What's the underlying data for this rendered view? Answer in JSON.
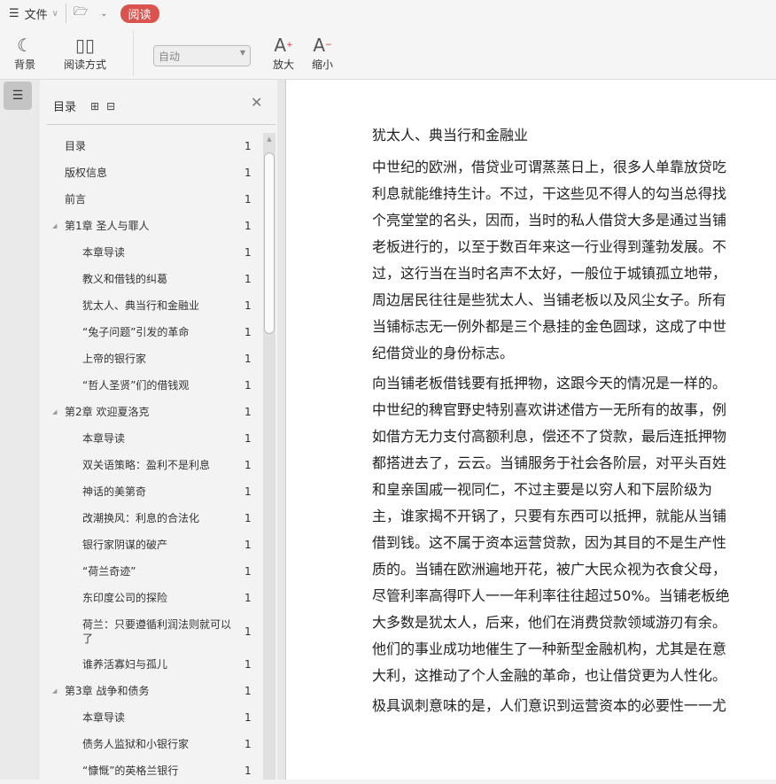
{
  "toolbar": {
    "file": "文件",
    "read_badge": "阅读",
    "background": "背景",
    "reading_mode": "阅读方式",
    "select_value": "自动",
    "zoom_in": "放大",
    "zoom_out": "缩小"
  },
  "toc": {
    "title": "目录",
    "items": [
      {
        "label": "目录",
        "page": "1",
        "level": 0
      },
      {
        "label": "版权信息",
        "page": "1",
        "level": 0
      },
      {
        "label": "前言",
        "page": "1",
        "level": 0
      },
      {
        "label": "第1章 圣人与罪人",
        "page": "1",
        "level": 0,
        "expandable": true
      },
      {
        "label": "本章导读",
        "page": "1",
        "level": 1
      },
      {
        "label": "教义和借钱的纠葛",
        "page": "1",
        "level": 1
      },
      {
        "label": "犹太人、典当行和金融业",
        "page": "1",
        "level": 1
      },
      {
        "label": "“兔子问题”引发的革命",
        "page": "1",
        "level": 1
      },
      {
        "label": "上帝的银行家",
        "page": "1",
        "level": 1
      },
      {
        "label": "“哲人圣贤”们的借钱观",
        "page": "1",
        "level": 1
      },
      {
        "label": "第2章 欢迎夏洛克",
        "page": "1",
        "level": 0,
        "expandable": true
      },
      {
        "label": "本章导读",
        "page": "1",
        "level": 1
      },
      {
        "label": "双关语策略：盈利不是利息",
        "page": "1",
        "level": 1
      },
      {
        "label": "神话的美第奇",
        "page": "1",
        "level": 1
      },
      {
        "label": "改潮换风：利息的合法化",
        "page": "1",
        "level": 1
      },
      {
        "label": "银行家阴谋的破产",
        "page": "1",
        "level": 1
      },
      {
        "label": "“荷兰奇迹”",
        "page": "1",
        "level": 1
      },
      {
        "label": "东印度公司的探险",
        "page": "1",
        "level": 1
      },
      {
        "label": "荷兰：只要遵循利润法则就可以了",
        "page": "1",
        "level": 1,
        "tall": true
      },
      {
        "label": "谁养活寡妇与孤儿",
        "page": "1",
        "level": 1
      },
      {
        "label": "第3章 战争和债务",
        "page": "1",
        "level": 0,
        "expandable": true
      },
      {
        "label": "本章导读",
        "page": "1",
        "level": 1
      },
      {
        "label": "债务人监狱和小银行家",
        "page": "1",
        "level": 1
      },
      {
        "label": "“慷慨”的英格兰银行",
        "page": "1",
        "level": 1
      }
    ]
  },
  "document": {
    "heading": "犹太人、典当行和金融业",
    "paragraphs": [
      "中世纪的欧洲，借贷业可谓蒸蒸日上，很多人单靠放贷吃利息就能维持生计。不过，干这些见不得人的勾当总得找个亮堂堂的名头，因而，当时的私人借贷大多是通过当铺老板进行的，以至于数百年来这一行业得到蓬勃发展。不过，这行当在当时名声不太好，一般位于城镇孤立地带，周边居民往往是些犹太人、当铺老板以及风尘女子。所有当铺标志无一例外都是三个悬挂的金色圆球，这成了中世纪借贷业的身份标志。",
      "向当铺老板借钱要有抵押物，这跟今天的情况是一样的。中世纪的稗官野史特别喜欢讲述借方一无所有的故事，例如借方无力支付高额利息，偿还不了贷款，最后连抵押物都搭进去了，云云。当铺服务于社会各阶层，对平头百姓和皇亲国戚一视同仁，不过主要是以穷人和下层阶级为主，谁家揭不开锅了，只要有东西可以抵押，就能从当铺借到钱。这不属于资本运营贷款，因为其目的不是生产性质的。当铺在欧洲遍地开花，被广大民众视为衣食父母，尽管利率高得吓人一一年利率往往超过50%。当铺老板绝大多数是犹太人，后来，他们在消费贷款领域游刃有余。他们的事业成功地催生了一种新型金融机构，尤其是在意大利，这推动了个人金融的革命，也让借贷更为人性化。",
      "极具讽刺意味的是，人们意识到运营资本的必要性一一尤"
    ]
  }
}
